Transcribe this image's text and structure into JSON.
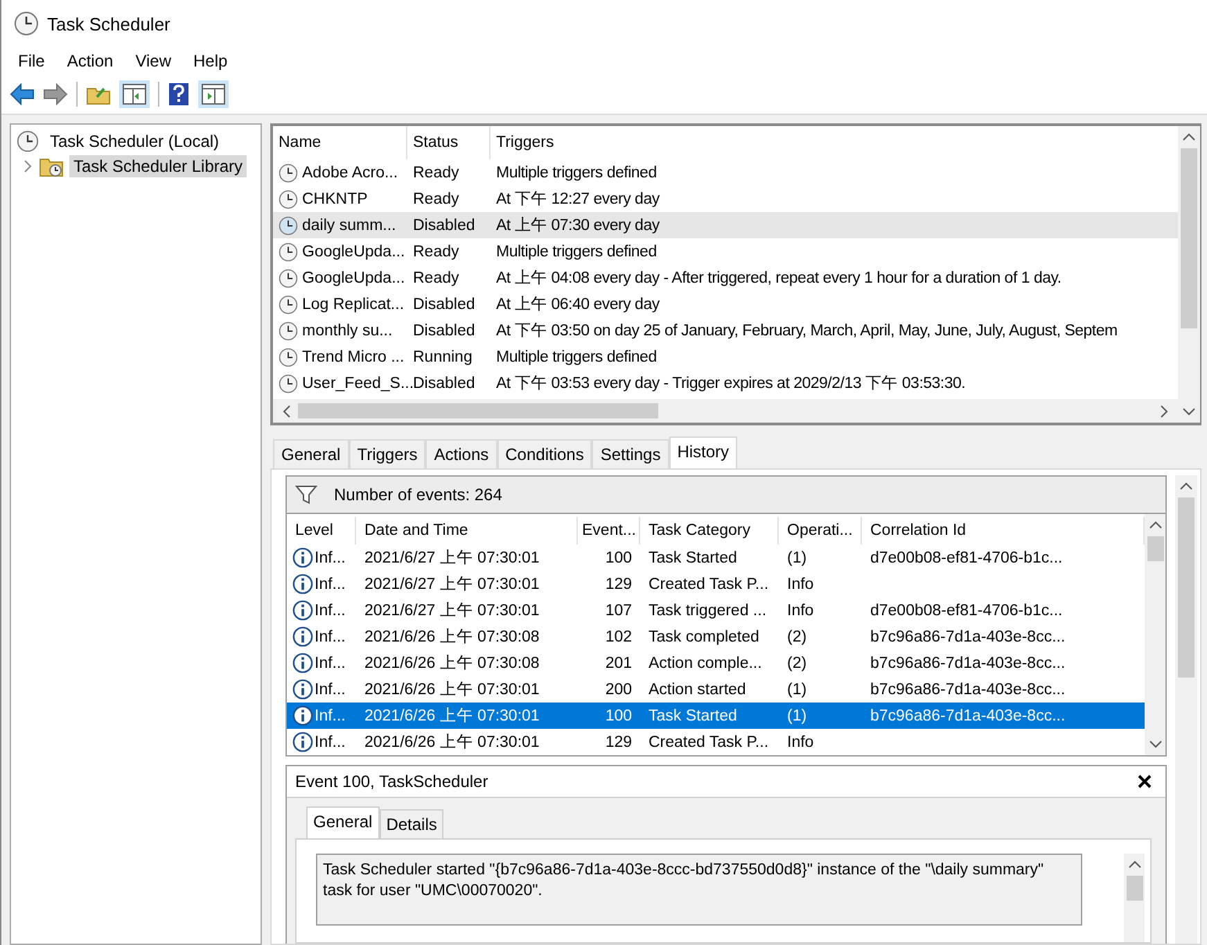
{
  "window": {
    "title": "Task Scheduler"
  },
  "menu": [
    "File",
    "Action",
    "View",
    "Help"
  ],
  "tree": [
    {
      "label": "Task Scheduler (Local)",
      "selected": false,
      "children": [
        {
          "label": "Task Scheduler Library",
          "selected": true,
          "expanded": false
        }
      ]
    }
  ],
  "tasks": {
    "columns": [
      "Name",
      "Status",
      "Triggers"
    ],
    "rows": [
      {
        "name": "Adobe Acro...",
        "status": "Ready",
        "triggers": "Multiple triggers defined",
        "selected": false
      },
      {
        "name": "CHKNTP",
        "status": "Ready",
        "triggers": "At 下午 12:27 every day",
        "selected": false
      },
      {
        "name": "daily summ...",
        "status": "Disabled",
        "triggers": "At 上午 07:30 every day",
        "selected": true
      },
      {
        "name": "GoogleUpda...",
        "status": "Ready",
        "triggers": "Multiple triggers defined",
        "selected": false
      },
      {
        "name": "GoogleUpda...",
        "status": "Ready",
        "triggers": "At 上午 04:08 every day - After triggered, repeat every 1 hour for a duration of 1 day.",
        "selected": false
      },
      {
        "name": "Log Replicat...",
        "status": "Disabled",
        "triggers": "At 上午 06:40 every day",
        "selected": false
      },
      {
        "name": "monthly su...",
        "status": "Disabled",
        "triggers": "At 下午 03:50  on day 25 of January, February, March, April, May, June, July, August, Septem",
        "selected": false
      },
      {
        "name": "Trend Micro ...",
        "status": "Running",
        "triggers": "Multiple triggers defined",
        "selected": false
      },
      {
        "name": "User_Feed_S...",
        "status": "Disabled",
        "triggers": "At 下午 03:53 every day - Trigger expires at 2029/2/13 下午 03:53:30.",
        "selected": false
      }
    ]
  },
  "tabs": [
    {
      "label": "General",
      "selected": false
    },
    {
      "label": "Triggers",
      "selected": false
    },
    {
      "label": "Actions",
      "selected": false
    },
    {
      "label": "Conditions",
      "selected": false
    },
    {
      "label": "Settings",
      "selected": false
    },
    {
      "label": "History",
      "selected": true
    }
  ],
  "history": {
    "filter_label": "Number of events: 264",
    "columns": [
      "Level",
      "Date and Time",
      "Event...",
      "Task Category",
      "Operati...",
      "Correlation Id"
    ],
    "rows": [
      {
        "level": "Inf...",
        "date_time": "2021/6/27 上午 07:30:01",
        "event_id": "100",
        "task_category": "Task Started",
        "operational_code": "(1)",
        "correlation_id": "d7e00b08-ef81-4706-b1c...",
        "selected": false
      },
      {
        "level": "Inf...",
        "date_time": "2021/6/27 上午 07:30:01",
        "event_id": "129",
        "task_category": "Created Task P...",
        "operational_code": "Info",
        "selected": false
      },
      {
        "level": "Inf...",
        "date_time": "2021/6/27 上午 07:30:01",
        "event_id": "107",
        "task_category": "Task triggered ...",
        "operational_code": "Info",
        "correlation_id": "d7e00b08-ef81-4706-b1c...",
        "selected": false
      },
      {
        "level": "Inf...",
        "date_time": "2021/6/26 上午 07:30:08",
        "event_id": "102",
        "task_category": "Task completed",
        "operational_code": "(2)",
        "correlation_id": "b7c96a86-7d1a-403e-8cc...",
        "selected": false
      },
      {
        "level": "Inf...",
        "date_time": "2021/6/26 上午 07:30:08",
        "event_id": "201",
        "task_category": "Action comple...",
        "operational_code": "(2)",
        "correlation_id": "b7c96a86-7d1a-403e-8cc...",
        "selected": false
      },
      {
        "level": "Inf...",
        "date_time": "2021/6/26 上午 07:30:01",
        "event_id": "200",
        "task_category": "Action started",
        "operational_code": "(1)",
        "correlation_id": "b7c96a86-7d1a-403e-8cc...",
        "selected": false
      },
      {
        "level": "Inf...",
        "date_time": "2021/6/26 上午 07:30:01",
        "event_id": "100",
        "task_category": "Task Started",
        "operational_code": "(1)",
        "correlation_id": "b7c96a86-7d1a-403e-8cc...",
        "selected": true
      },
      {
        "level": "Inf...",
        "date_time": "2021/6/26 上午 07:30:01",
        "event_id": "129",
        "task_category": "Created Task P...",
        "operational_code": "Info",
        "selected": false
      }
    ]
  },
  "event_panel": {
    "title": "Event 100, TaskScheduler",
    "tabs": [
      {
        "label": "General",
        "selected": true
      },
      {
        "label": "Details",
        "selected": false
      }
    ],
    "message": "Task Scheduler started \"{b7c96a86-7d1a-403e-8ccc-bd737550d0d8}\" instance of the \"\\daily summary\" task for user \"UMC\\00070020\"."
  }
}
